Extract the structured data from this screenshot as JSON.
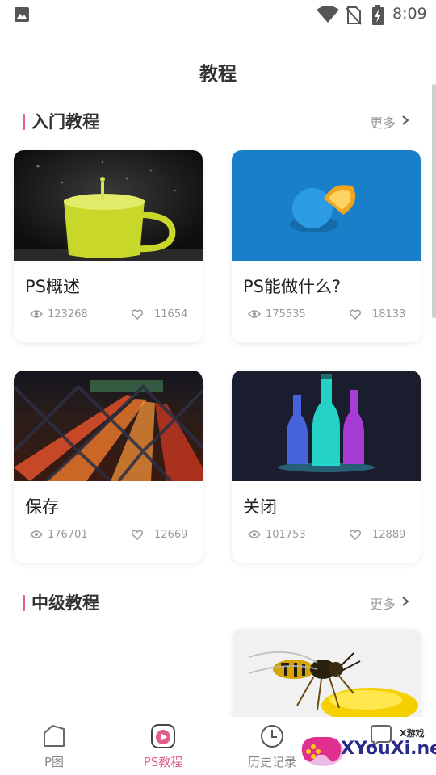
{
  "status_bar": {
    "time": "8:09",
    "icons": [
      "gallery-icon",
      "wifi-icon",
      "no-sim-icon",
      "battery-charging-icon"
    ]
  },
  "page": {
    "title": "教程"
  },
  "sections": [
    {
      "title": "入门教程",
      "more_label": "更多",
      "cards": [
        {
          "title": "PS概述",
          "views": "123268",
          "likes": "11654",
          "image": "yellow-cup-splash"
        },
        {
          "title": "PS能做什么?",
          "views": "175535",
          "likes": "18133",
          "image": "blue-orange-on-blue"
        },
        {
          "title": "保存",
          "views": "176701",
          "likes": "12669",
          "image": "highway-lights-through-fence"
        },
        {
          "title": "关闭",
          "views": "101753",
          "likes": "12889",
          "image": "glowing-bottles"
        }
      ]
    },
    {
      "title": "中级教程",
      "more_label": "更多",
      "cards": [
        {
          "title": "",
          "image": "blank"
        },
        {
          "title": "",
          "image": "wasp-on-yellow-drop"
        }
      ]
    }
  ],
  "tabbar": {
    "tabs": [
      {
        "label": "P图",
        "icon": "hexagon-icon",
        "active": false
      },
      {
        "label": "PS教程",
        "icon": "play-icon",
        "active": true
      },
      {
        "label": "历史记录",
        "icon": "clock-icon",
        "active": false
      },
      {
        "label": "",
        "icon": "message-icon",
        "active": false
      }
    ]
  },
  "watermark": {
    "top": "X游戏",
    "main": "XYouXi.net"
  },
  "colors": {
    "accent": "#e0608a",
    "muted": "#999999",
    "title": "#333333"
  }
}
